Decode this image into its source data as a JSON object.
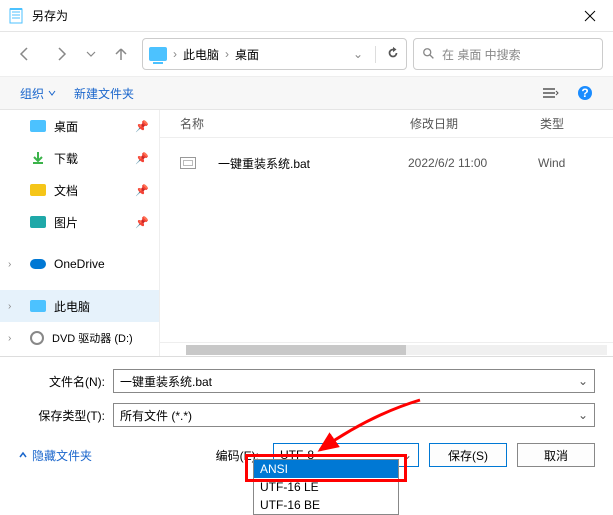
{
  "title": "另存为",
  "path": {
    "pc": "此电脑",
    "desktop": "桌面"
  },
  "search_placeholder": "在 桌面 中搜索",
  "toolbar": {
    "organize": "组织",
    "new_folder": "新建文件夹"
  },
  "sidebar": {
    "items": [
      {
        "label": "桌面",
        "icon": "blue",
        "pin": true
      },
      {
        "label": "下载",
        "icon": "green",
        "pin": true
      },
      {
        "label": "文档",
        "icon": "yellow",
        "pin": true
      },
      {
        "label": "图片",
        "icon": "teal",
        "pin": true
      }
    ],
    "onedrive": "OneDrive",
    "this_pc": "此电脑",
    "dvd": "DVD 驱动器 (D:)"
  },
  "file_header": {
    "name": "名称",
    "date": "修改日期",
    "type": "类型"
  },
  "files": [
    {
      "name": "一键重装系统.bat",
      "date": "2022/6/2 11:00",
      "type": "Wind"
    }
  ],
  "form": {
    "filename_label": "文件名(N):",
    "filename_value": "一键重装系统.bat",
    "type_label": "保存类型(T):",
    "type_value": "所有文件 (*.*)"
  },
  "footer": {
    "hide_folders": "隐藏文件夹",
    "encoding_label": "编码(E):",
    "encoding_value": "UTF-8",
    "save": "保存(S)",
    "cancel": "取消"
  },
  "encoding_options": [
    "ANSI",
    "UTF-16 LE",
    "UTF-16 BE"
  ]
}
